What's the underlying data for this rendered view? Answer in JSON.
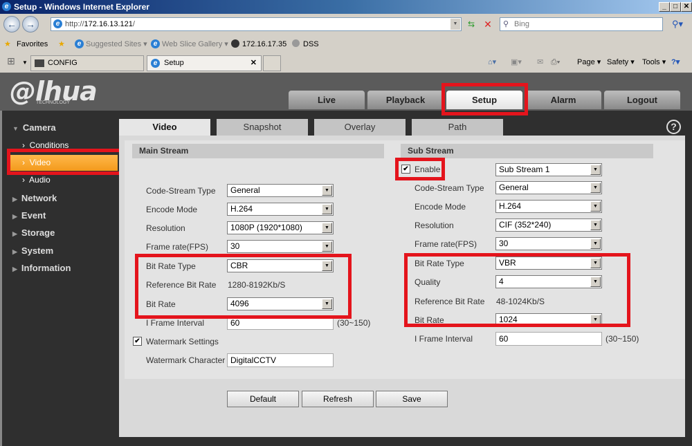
{
  "browser": {
    "title": "Setup - Windows Internet Explorer",
    "url_prefix": "http://",
    "url_host": "172.16.13.121",
    "url_suffix": "/",
    "search_placeholder": "Bing",
    "favorites": {
      "label": "Favorites",
      "suggested": "Suggested Sites ▾",
      "webslice": "Web Slice Gallery ▾",
      "link1": "172.16.17.35",
      "link2": "DSS"
    },
    "tabs": [
      {
        "label": "CONFIG"
      },
      {
        "label": "Setup"
      }
    ],
    "commands": {
      "page": "Page ▾",
      "safety": "Safety ▾",
      "tools": "Tools ▾"
    }
  },
  "app": {
    "logo": "alhua",
    "logo_sub": "TECHNOLOGY",
    "nav": [
      "Live",
      "Playback",
      "Setup",
      "Alarm",
      "Logout"
    ],
    "sidebar": {
      "camera": "Camera",
      "camera_items": [
        "Conditions",
        "Video",
        "Audio"
      ],
      "others": [
        "Network",
        "Event",
        "Storage",
        "System",
        "Information"
      ]
    },
    "content_tabs": [
      "Video",
      "Snapshot",
      "Overlay",
      "Path"
    ],
    "main": {
      "title": "Main Stream",
      "rows": [
        {
          "label": "Code-Stream Type",
          "value": "General"
        },
        {
          "label": "Encode Mode",
          "value": "H.264"
        },
        {
          "label": "Resolution",
          "value": "1080P (1920*1080)"
        },
        {
          "label": "Frame rate(FPS)",
          "value": "30"
        },
        {
          "label": "Bit Rate Type",
          "value": "CBR"
        },
        {
          "label": "Reference Bit Rate",
          "value": "1280-8192Kb/S"
        },
        {
          "label": "Bit Rate",
          "value": "4096"
        },
        {
          "label": "I Frame Interval",
          "value": "60",
          "hint": "(30~150)"
        }
      ],
      "watermark_settings": "Watermark Settings",
      "watermark_char_label": "Watermark Character",
      "watermark_char": "DigitalCCTV"
    },
    "sub": {
      "title": "Sub Stream",
      "enable": "Enable",
      "stream": "Sub Stream 1",
      "rows": [
        {
          "label": "Code-Stream Type",
          "value": "General"
        },
        {
          "label": "Encode Mode",
          "value": "H.264"
        },
        {
          "label": "Resolution",
          "value": "CIF (352*240)"
        },
        {
          "label": "Frame rate(FPS)",
          "value": "30"
        },
        {
          "label": "Bit Rate Type",
          "value": "VBR"
        },
        {
          "label": "Quality",
          "value": "4"
        },
        {
          "label": "Reference Bit Rate",
          "value": "48-1024Kb/S"
        },
        {
          "label": "Bit Rate",
          "value": "1024"
        },
        {
          "label": "I Frame Interval",
          "value": "60",
          "hint": "(30~150)"
        }
      ]
    },
    "buttons": [
      "Default",
      "Refresh",
      "Save"
    ],
    "help": "?"
  }
}
